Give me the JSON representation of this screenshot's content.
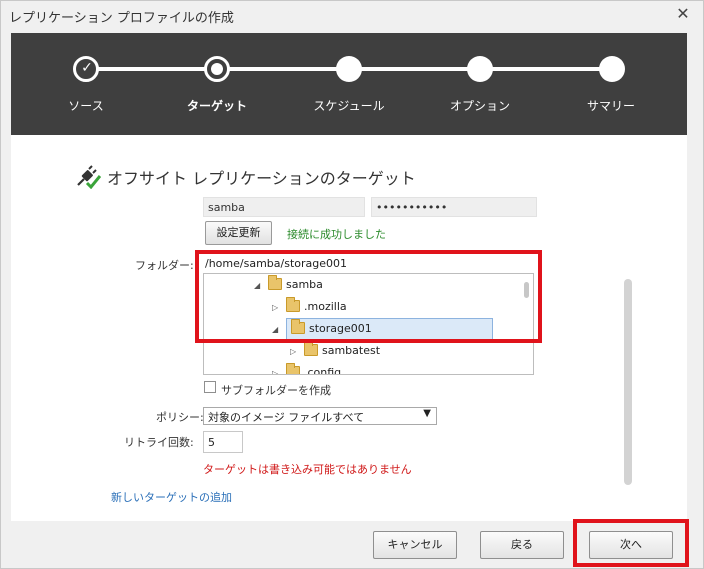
{
  "window": {
    "title": "レプリケーション プロファイルの作成"
  },
  "wizard": {
    "steps": [
      {
        "label": "ソース",
        "state": "done"
      },
      {
        "label": "ターゲット",
        "state": "current"
      },
      {
        "label": "スケジュール",
        "state": "pending"
      },
      {
        "label": "オプション",
        "state": "pending"
      },
      {
        "label": "サマリー",
        "state": "pending"
      }
    ]
  },
  "section": {
    "heading": "オフサイト レプリケーションのターゲット"
  },
  "credentials": {
    "username": "samba",
    "password": "•••••••••••"
  },
  "refresh": {
    "button_label": "設定更新",
    "status": "接続に成功しました"
  },
  "folder": {
    "label": "フォルダー:",
    "path": "/home/samba/storage001",
    "tree": [
      {
        "name": "samba",
        "expanded": true
      },
      {
        "name": ".mozilla",
        "expanded": false
      },
      {
        "name": "storage001",
        "expanded": true,
        "selected": true
      },
      {
        "name": "sambatest",
        "expanded": false
      },
      {
        "name": ".config",
        "expanded": false
      }
    ],
    "create_subfolder_label": "サブフォルダーを作成"
  },
  "policy": {
    "label": "ポリシー:",
    "selected": "対象のイメージ ファイルすべて"
  },
  "retry": {
    "label": "リトライ回数:",
    "value": "5"
  },
  "error_message": "ターゲットは書き込み可能ではありません",
  "add_target_link": "新しいターゲットの追加",
  "footer": {
    "cancel": "キャンセル",
    "back": "戻る",
    "next": "次へ"
  },
  "colors": {
    "highlight_box": "#e0131b",
    "header_bg": "#3f3f3f",
    "success": "#2a8a2a",
    "error": "#d01818",
    "link": "#2a6fb8"
  }
}
